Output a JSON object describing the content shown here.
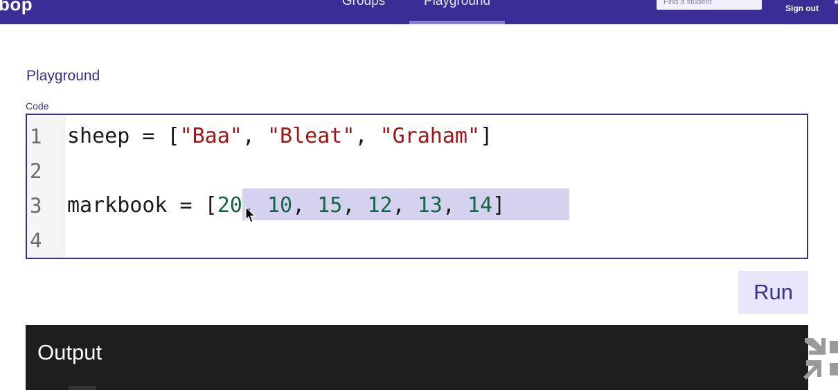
{
  "app": {
    "logo": "bop"
  },
  "nav": {
    "tabs": [
      {
        "label": "Groups",
        "active": false
      },
      {
        "label": "Playground",
        "active": true
      }
    ]
  },
  "search": {
    "placeholder": "Find a student",
    "value": ""
  },
  "account": {
    "sign_out_label": "Sign out"
  },
  "page": {
    "title": "Playground"
  },
  "editor": {
    "label": "Code",
    "lines": [
      {
        "number": "1"
      },
      {
        "number": "2"
      },
      {
        "number": "3"
      },
      {
        "number": "4"
      }
    ],
    "line1": {
      "var": "sheep",
      "op": " = [",
      "s1": "\"Baa\"",
      "sep1": ", ",
      "s2": "\"Bleat\"",
      "sep2": ", ",
      "s3": "\"Graham\"",
      "close": "]"
    },
    "line3": {
      "var": "markbook",
      "op": " = [",
      "numbers": [
        "20",
        "10",
        "15",
        "12",
        "13",
        "14"
      ],
      "close": "]"
    },
    "selected_text": "20, 10, 15, 12, 13, 14"
  },
  "actions": {
    "run_label": "Run"
  },
  "output": {
    "title": "Output"
  },
  "colors": {
    "brand": "#3a2d96",
    "nav_underline": "#8a7ed6",
    "string": "#a31515",
    "number": "#116644",
    "selection": "#d4d2ee",
    "output_bg": "#1e1e1e"
  },
  "icons": {
    "cursor": "mouse-pointer-icon",
    "collapse": "collapse-arrows-icon"
  }
}
